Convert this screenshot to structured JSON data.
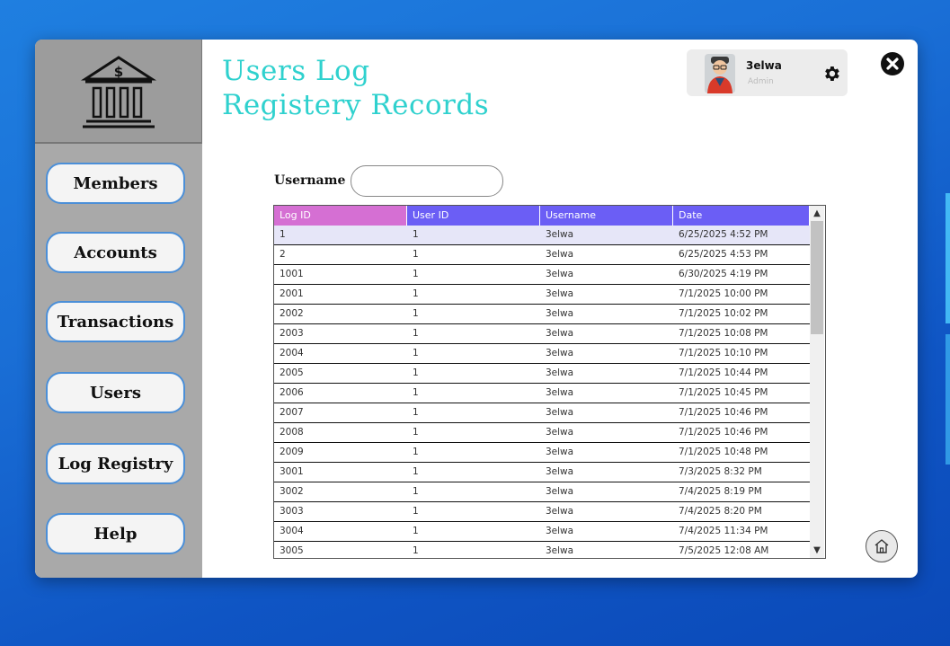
{
  "page": {
    "title_line1": "Users Log",
    "title_line2": "Registery Records"
  },
  "user": {
    "name": "3elwa",
    "role": "Admin"
  },
  "sidebar": {
    "items": [
      {
        "label": "Members"
      },
      {
        "label": "Accounts"
      },
      {
        "label": "Transactions"
      },
      {
        "label": "Users"
      },
      {
        "label": "Log Registry"
      },
      {
        "label": "Help"
      }
    ]
  },
  "filter": {
    "label": "Username",
    "value": ""
  },
  "table": {
    "columns": [
      "Log ID",
      "User ID",
      "Username",
      "Date"
    ],
    "header_colors": [
      "#d56fd3",
      "#6b5ef5",
      "#6b5ef5",
      "#6b5ef5"
    ],
    "selected_row": 0,
    "rows": [
      [
        "1",
        "1",
        "3elwa",
        "6/25/2025 4:52 PM"
      ],
      [
        "2",
        "1",
        "3elwa",
        "6/25/2025 4:53 PM"
      ],
      [
        "1001",
        "1",
        "3elwa",
        "6/30/2025 4:19 PM"
      ],
      [
        "2001",
        "1",
        "3elwa",
        "7/1/2025 10:00 PM"
      ],
      [
        "2002",
        "1",
        "3elwa",
        "7/1/2025 10:02 PM"
      ],
      [
        "2003",
        "1",
        "3elwa",
        "7/1/2025 10:08 PM"
      ],
      [
        "2004",
        "1",
        "3elwa",
        "7/1/2025 10:10 PM"
      ],
      [
        "2005",
        "1",
        "3elwa",
        "7/1/2025 10:44 PM"
      ],
      [
        "2006",
        "1",
        "3elwa",
        "7/1/2025 10:45 PM"
      ],
      [
        "2007",
        "1",
        "3elwa",
        "7/1/2025 10:46 PM"
      ],
      [
        "2008",
        "1",
        "3elwa",
        "7/1/2025 10:46 PM"
      ],
      [
        "2009",
        "1",
        "3elwa",
        "7/1/2025 10:48 PM"
      ],
      [
        "3001",
        "1",
        "3elwa",
        "7/3/2025 8:32 PM"
      ],
      [
        "3002",
        "1",
        "3elwa",
        "7/4/2025 8:19 PM"
      ],
      [
        "3003",
        "1",
        "3elwa",
        "7/4/2025 8:20 PM"
      ],
      [
        "3004",
        "1",
        "3elwa",
        "7/4/2025 11:34 PM"
      ],
      [
        "3005",
        "1",
        "3elwa",
        "7/5/2025 12:08 AM"
      ]
    ]
  },
  "colors": {
    "title": "#2fd1ce",
    "sidebar_bg": "#a9a9a9",
    "nav_border": "#4b8fd8",
    "desktop_bg": "#1a6fd6"
  },
  "icons": {
    "logo": "bank-dollar-icon",
    "settings": "gear-icon",
    "close": "close-icon",
    "home": "home-icon"
  }
}
